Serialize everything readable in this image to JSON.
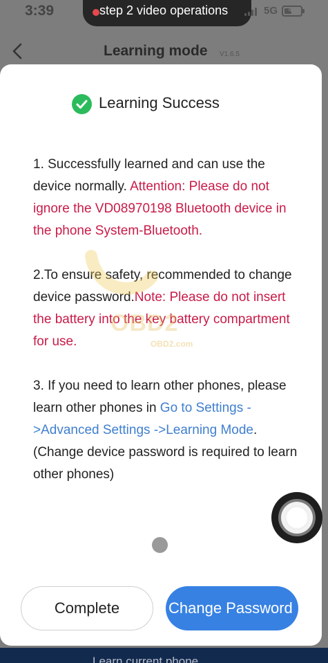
{
  "status_bar": {
    "time": "3:39",
    "recording_label": "step 2 video operations",
    "network": "5G",
    "battery": "43"
  },
  "nav": {
    "title": "Learning mode",
    "version": "V1.6.5"
  },
  "background_button": {
    "label": "Learn current phone"
  },
  "dialog": {
    "title": "Learning Success",
    "item1": {
      "text": "1. Successfully learned and can use the device normally.",
      "attention": "Attention: Please do not ignore the VD08970198 Bluetooth device in the phone System-Bluetooth."
    },
    "item2": {
      "text": "2.To ensure safety, recommended to change device password.",
      "note": "Note: Please do not insert the battery into the key battery compartment for use."
    },
    "item3": {
      "text_before": "3. If you need to learn other phones, please learn other phones in ",
      "link": "Go to Settings ->Advanced Settings ->Learning Mode",
      "text_after": ". (Change device password is required to learn other phones)"
    },
    "complete_button": "Complete",
    "change_password_button": "Change Password"
  },
  "watermark": {
    "brand": "OBD2",
    "url": "OBD2.com"
  },
  "colors": {
    "accent_blue": "#3781e3",
    "warning_red": "#c81b48",
    "success_green": "#2bbb5c",
    "link_blue": "#3f7fcf"
  }
}
